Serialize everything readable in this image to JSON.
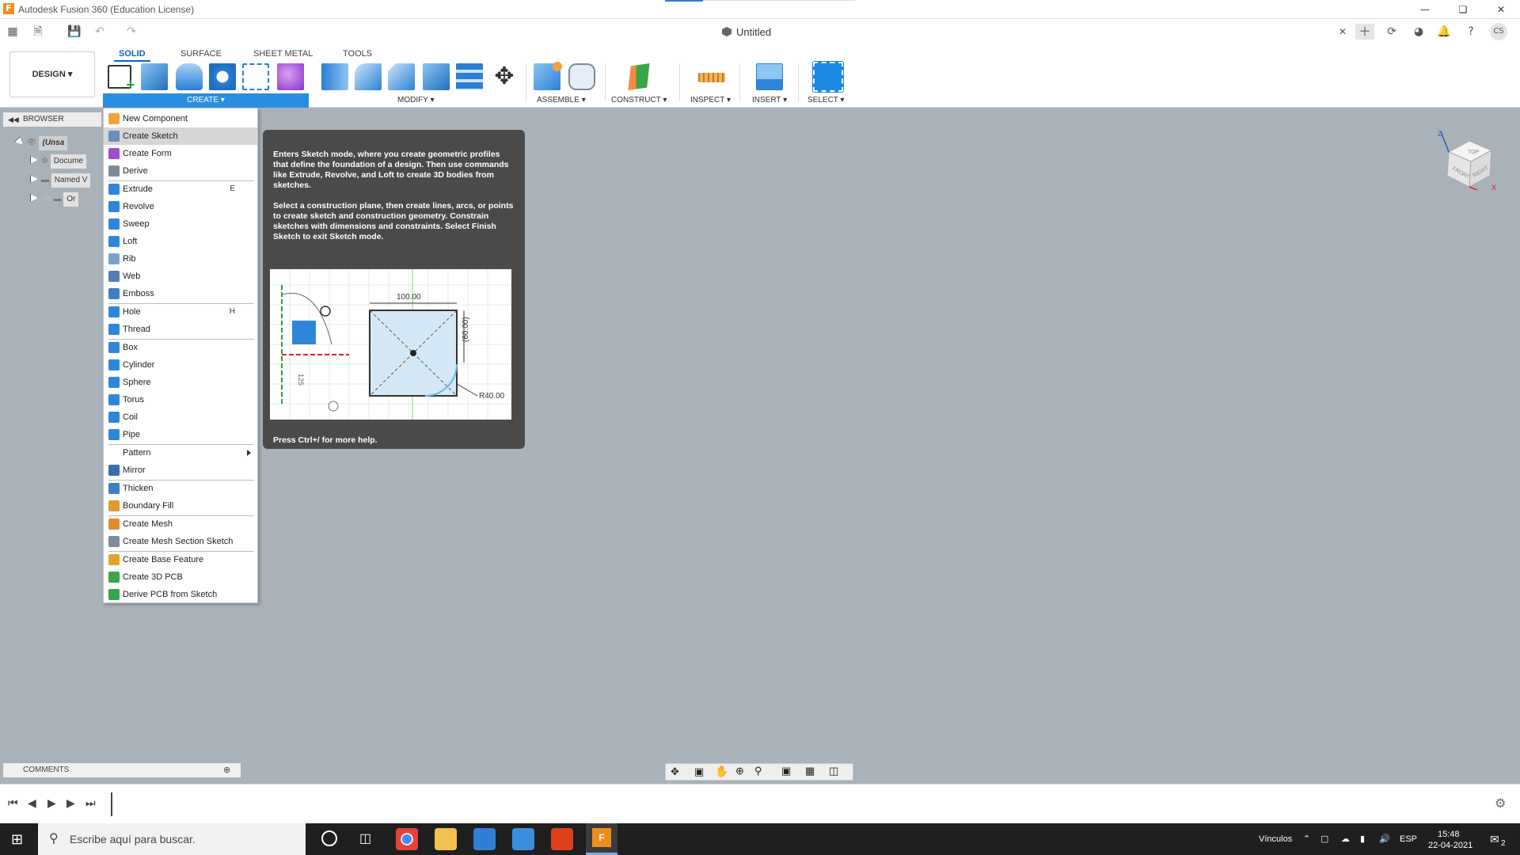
{
  "window": {
    "title": "Autodesk Fusion 360 (Education License)",
    "document_title": "Untitled",
    "user_initials": "CS"
  },
  "workspace": {
    "label": "DESIGN"
  },
  "tabs": [
    "SOLID",
    "SURFACE",
    "SHEET METAL",
    "TOOLS"
  ],
  "groups": {
    "create": "CREATE",
    "modify": "MODIFY",
    "assemble": "ASSEMBLE",
    "construct": "CONSTRUCT",
    "inspect": "INSPECT",
    "insert": "INSERT",
    "select": "SELECT"
  },
  "browser": {
    "header": "BROWSER",
    "items": [
      "(Unsa",
      "Docume",
      "Named V",
      "Or"
    ]
  },
  "create_menu": [
    {
      "label": "New Component",
      "shortcut": "",
      "icon": "component-icon",
      "color": "#f2a23c"
    },
    {
      "label": "Create Sketch",
      "shortcut": "",
      "icon": "sketch-icon",
      "color": "#6a8fb8",
      "highlight": true
    },
    {
      "label": "Create Form",
      "shortcut": "",
      "icon": "form-icon",
      "color": "#a04ccf"
    },
    {
      "label": "Derive",
      "shortcut": "",
      "icon": "derive-icon",
      "color": "#7c8c9a",
      "sep_after": true
    },
    {
      "label": "Extrude",
      "shortcut": "E",
      "icon": "extrude-icon",
      "color": "#2f86d8"
    },
    {
      "label": "Revolve",
      "shortcut": "",
      "icon": "revolve-icon",
      "color": "#2f86d8"
    },
    {
      "label": "Sweep",
      "shortcut": "",
      "icon": "sweep-icon",
      "color": "#2f86d8"
    },
    {
      "label": "Loft",
      "shortcut": "",
      "icon": "loft-icon",
      "color": "#2f86d8"
    },
    {
      "label": "Rib",
      "shortcut": "",
      "icon": "rib-icon",
      "color": "#7aa3c9"
    },
    {
      "label": "Web",
      "shortcut": "",
      "icon": "web-icon",
      "color": "#4f7fb3"
    },
    {
      "label": "Emboss",
      "shortcut": "",
      "icon": "emboss-icon",
      "color": "#3d7fc4",
      "sep_after": true
    },
    {
      "label": "Hole",
      "shortcut": "H",
      "icon": "hole-icon",
      "color": "#2f86d8"
    },
    {
      "label": "Thread",
      "shortcut": "",
      "icon": "thread-icon",
      "color": "#2f86d8",
      "sep_after": true
    },
    {
      "label": "Box",
      "shortcut": "",
      "icon": "box-icon",
      "color": "#2f86d8"
    },
    {
      "label": "Cylinder",
      "shortcut": "",
      "icon": "cylinder-icon",
      "color": "#2f86d8"
    },
    {
      "label": "Sphere",
      "shortcut": "",
      "icon": "sphere-icon",
      "color": "#2f86d8"
    },
    {
      "label": "Torus",
      "shortcut": "",
      "icon": "torus-icon",
      "color": "#2f86d8"
    },
    {
      "label": "Coil",
      "shortcut": "",
      "icon": "coil-icon",
      "color": "#2f86d8"
    },
    {
      "label": "Pipe",
      "shortcut": "",
      "icon": "pipe-icon",
      "color": "#2f86d8",
      "sep_after": true
    },
    {
      "label": "Pattern",
      "shortcut": "",
      "icon": "",
      "color": "",
      "submenu": true
    },
    {
      "label": "Mirror",
      "shortcut": "",
      "icon": "mirror-icon",
      "color": "#3a6ea5",
      "sep_after": true
    },
    {
      "label": "Thicken",
      "shortcut": "",
      "icon": "thicken-icon",
      "color": "#3d7fc4"
    },
    {
      "label": "Boundary Fill",
      "shortcut": "",
      "icon": "boundary-fill-icon",
      "color": "#e39a2c",
      "sep_after": true
    },
    {
      "label": "Create Mesh",
      "shortcut": "",
      "icon": "mesh-icon",
      "color": "#e38d2c"
    },
    {
      "label": "Create Mesh Section Sketch",
      "shortcut": "",
      "icon": "mesh-section-icon",
      "color": "#7c8c9a",
      "sep_after": true
    },
    {
      "label": "Create Base Feature",
      "shortcut": "",
      "icon": "base-feature-icon",
      "color": "#e3a32c"
    },
    {
      "label": "Create 3D PCB",
      "shortcut": "",
      "icon": "pcb-icon",
      "color": "#3aa44a"
    },
    {
      "label": "Derive PCB from Sketch",
      "shortcut": "",
      "icon": "derive-pcb-icon",
      "color": "#3aa44a"
    }
  ],
  "tooltip": {
    "para1": "Enters Sketch mode, where you create geometric profiles that define the foundation of a design. Then use commands like Extrude, Revolve, and Loft to create 3D bodies from sketches.",
    "para2": "Select a construction plane, then create lines, arcs, or points to create sketch and construction geometry. Constrain sketches with dimensions and constraints. Select Finish Sketch to exit Sketch mode.",
    "footer": "Press Ctrl+/ for more help.",
    "figure": {
      "dim_top": "100.00",
      "dim_right": "(60.00)",
      "dim_left": "125",
      "radius": "R40.00"
    }
  },
  "comments": {
    "label": "COMMENTS"
  },
  "viewcube": {
    "top": "TOP",
    "front": "FRONT",
    "right": "RIGHT",
    "z": "Z",
    "x": "X"
  },
  "taskbar": {
    "search_placeholder": "Escribe aquí para buscar.",
    "tray_links": "Vínculos",
    "language": "ESP",
    "time": "15:48",
    "date": "22-04-2021",
    "notifications": "2"
  },
  "colors": {
    "accent": "#2a8ee0",
    "viewport": "#a9b2b9",
    "tooltip_bg": "#4a4a4a"
  }
}
